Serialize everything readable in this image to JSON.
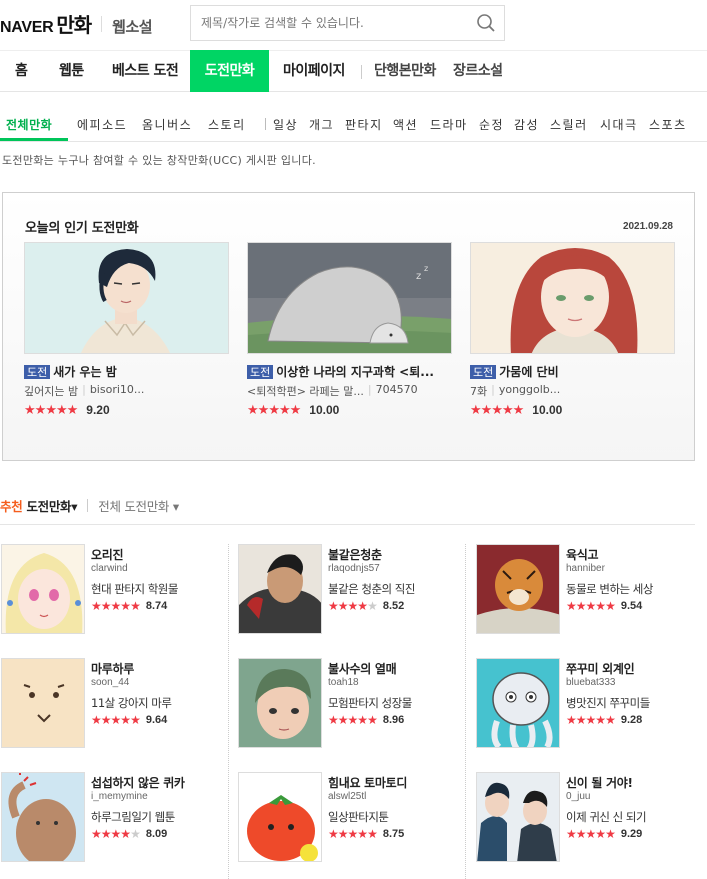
{
  "header": {
    "logo_brand": "NAVER",
    "logo_service": "만화",
    "logo_sub": "웹소설",
    "search_placeholder": "제목/작가로 검색할 수 있습니다."
  },
  "gnb": {
    "items": [
      "홈",
      "웹툰",
      "베스트 도전",
      "도전만화",
      "마이페이지",
      "단행본만화",
      "장르소설"
    ],
    "active_index": 3,
    "accent_color": "#00d564"
  },
  "genre_tabs": {
    "items": [
      "전체만화",
      "에피소드",
      "옴니버스",
      "스토리",
      "일상",
      "개그",
      "판타지",
      "액션",
      "드라마",
      "순정",
      "감성",
      "스릴러",
      "시대극",
      "스포츠"
    ],
    "active_index": 0
  },
  "description": "도전만화는 누구나 참여할 수 있는 창작만화(UCC) 게시판 입니다.",
  "popular": {
    "title": "오늘의 인기 도전만화",
    "date": "2021.09.28",
    "badge": "도전",
    "cards": [
      {
        "title": "새가 우는 밤",
        "meta1": "깊어지는 밤",
        "meta2": "bisori10...",
        "score": "9.20",
        "stars": 4.5
      },
      {
        "title": "이상한 나라의 지구과학 <퇴...",
        "meta1": "<퇴적학편> 라페는 말...",
        "meta2": "704570",
        "score": "10.00",
        "stars": 5
      },
      {
        "title": "가뭄에 단비",
        "meta1": "7화",
        "meta2": "yonggolb...",
        "score": "10.00",
        "stars": 5
      }
    ]
  },
  "recommend": {
    "tab_highlight": "추천",
    "tab1_rest": " 도전만화",
    "tab1_arrow": "▾",
    "tab2": "전체 도전만화",
    "tab2_arrow": "▾",
    "items": [
      {
        "title": "오리진",
        "author": "clarwind",
        "desc": "현대 판타지 학원물",
        "score": "8.74",
        "stars": 4.5
      },
      {
        "title": "불같은청춘",
        "author": "rlaqodnjs57",
        "desc": "불같은 청춘의 직진",
        "score": "8.52",
        "stars": 4
      },
      {
        "title": "육식고",
        "author": "hanniber",
        "desc": "동물로 변하는 세상",
        "score": "9.54",
        "stars": 5
      },
      {
        "title": "마루하루",
        "author": "soon_44",
        "desc": "11살 강아지 마루",
        "score": "9.64",
        "stars": 5
      },
      {
        "title": "불사수의 열매",
        "author": "toah18",
        "desc": "모험판타지 성장물",
        "score": "8.96",
        "stars": 4.5
      },
      {
        "title": "쭈꾸미 외계인",
        "author": "bluebat333",
        "desc": "병맛진지 쭈꾸미들",
        "score": "9.28",
        "stars": 4.5
      },
      {
        "title": "섭섭하지 않은 퀴카",
        "author": "i_memymine",
        "desc": "하루그림일기 웹툰",
        "score": "8.09",
        "stars": 4
      },
      {
        "title": "힘내요 토마토디",
        "author": "alswl25tl",
        "desc": "일상판타지툰",
        "score": "8.75",
        "stars": 4.5
      },
      {
        "title": "신이 될 거야!",
        "author": "0_juu",
        "desc": "이제 귀신 신 되기",
        "score": "9.29",
        "stars": 4.5
      }
    ]
  },
  "colors": {
    "star": "#ef3a44",
    "badge": "#3d5ea9",
    "genre_active": "#00b04e",
    "recommend_highlight": "#f55d1d"
  }
}
